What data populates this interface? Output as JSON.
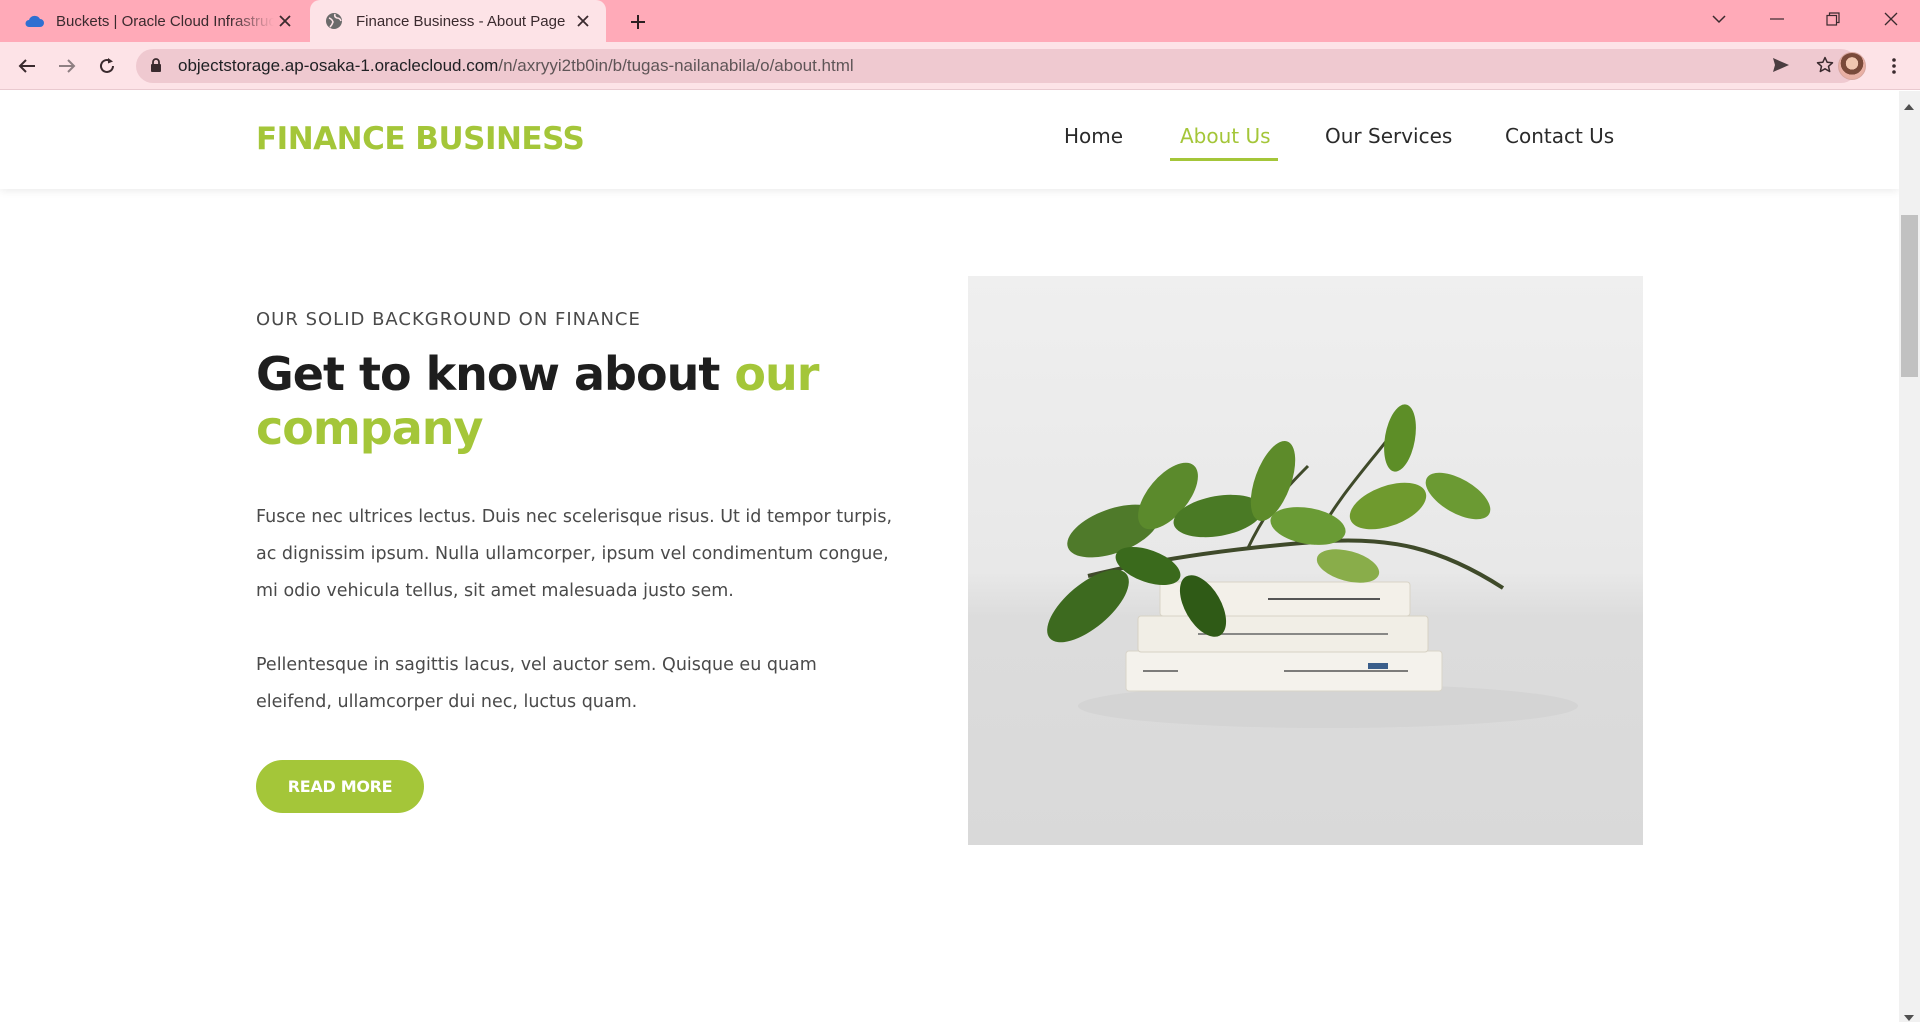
{
  "browser": {
    "tabs": [
      {
        "title": "Buckets | Oracle Cloud Infrastructure",
        "favicon": "cloud-icon",
        "active": false
      },
      {
        "title": "Finance Business - About Page",
        "favicon": "globe-icon",
        "active": true
      }
    ],
    "url_host": "objectstorage.ap-osaka-1.oraclecloud.com",
    "url_path": "/n/axryyi2tb0in/b/tugas-nailanabila/o/about.html"
  },
  "site": {
    "logo": "FINANCE BUSINESS",
    "nav": [
      {
        "label": "Home",
        "active": false
      },
      {
        "label": "About Us",
        "active": true
      },
      {
        "label": "Our Services",
        "active": false
      },
      {
        "label": "Contact Us",
        "active": false
      }
    ]
  },
  "about": {
    "eyebrow": "OUR SOLID BACKGROUND ON FINANCE",
    "headline_dark": "Get to know about ",
    "headline_accent": "our company",
    "paragraph1": "Fusce nec ultrices lectus. Duis nec scelerisque risus. Ut id tempor turpis, ac dignissim ipsum. Nulla ullamcorper, ipsum vel condimentum congue, mi odio vehicula tellus, sit amet malesuada justo sem.",
    "paragraph2": "Pellentesque in sagittis lacus, vel auctor sem. Quisque eu quam eleifend, ullamcorper dui nec, luctus quam.",
    "button": "READ MORE"
  },
  "colors": {
    "accent": "#a4c639",
    "tabbar": "#ffaab8",
    "toolbar": "#fde3e7"
  }
}
